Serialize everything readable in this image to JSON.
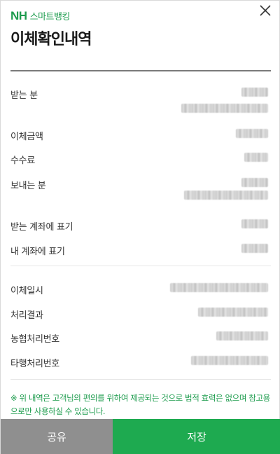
{
  "header": {
    "brand_nh": "NH",
    "brand_name": "스마트뱅킹",
    "title": "이체확인내역",
    "close_icon": "close-icon"
  },
  "rows": [
    {
      "label": "받는 분",
      "value_hidden": true
    },
    {
      "label": "이체금액",
      "value_hidden": true
    },
    {
      "label": "수수료",
      "value_hidden": true
    },
    {
      "label": "보내는 분",
      "value_hidden": true
    },
    {
      "label": "받는 계좌에 표기",
      "value_hidden": true
    },
    {
      "label": "내 계좌에 표기",
      "value_hidden": true
    },
    {
      "label": "이체일시",
      "value_hidden": true
    },
    {
      "label": "처리결과",
      "value_hidden": true
    },
    {
      "label": "농협처리번호",
      "value_hidden": true
    },
    {
      "label": "타행처리번호",
      "value_hidden": true
    }
  ],
  "notice": "※ 위 내역은 고객님의 편의를 위하여 제공되는 것으로 법적 효력은 없으며 참고용으로만 사용하실 수 있습니다.",
  "footer": {
    "share_label": "공유",
    "save_label": "저장"
  },
  "colors": {
    "brand_green": "#1e9c4e",
    "save_button": "#1eaa50",
    "share_button": "#8f8f8f"
  }
}
